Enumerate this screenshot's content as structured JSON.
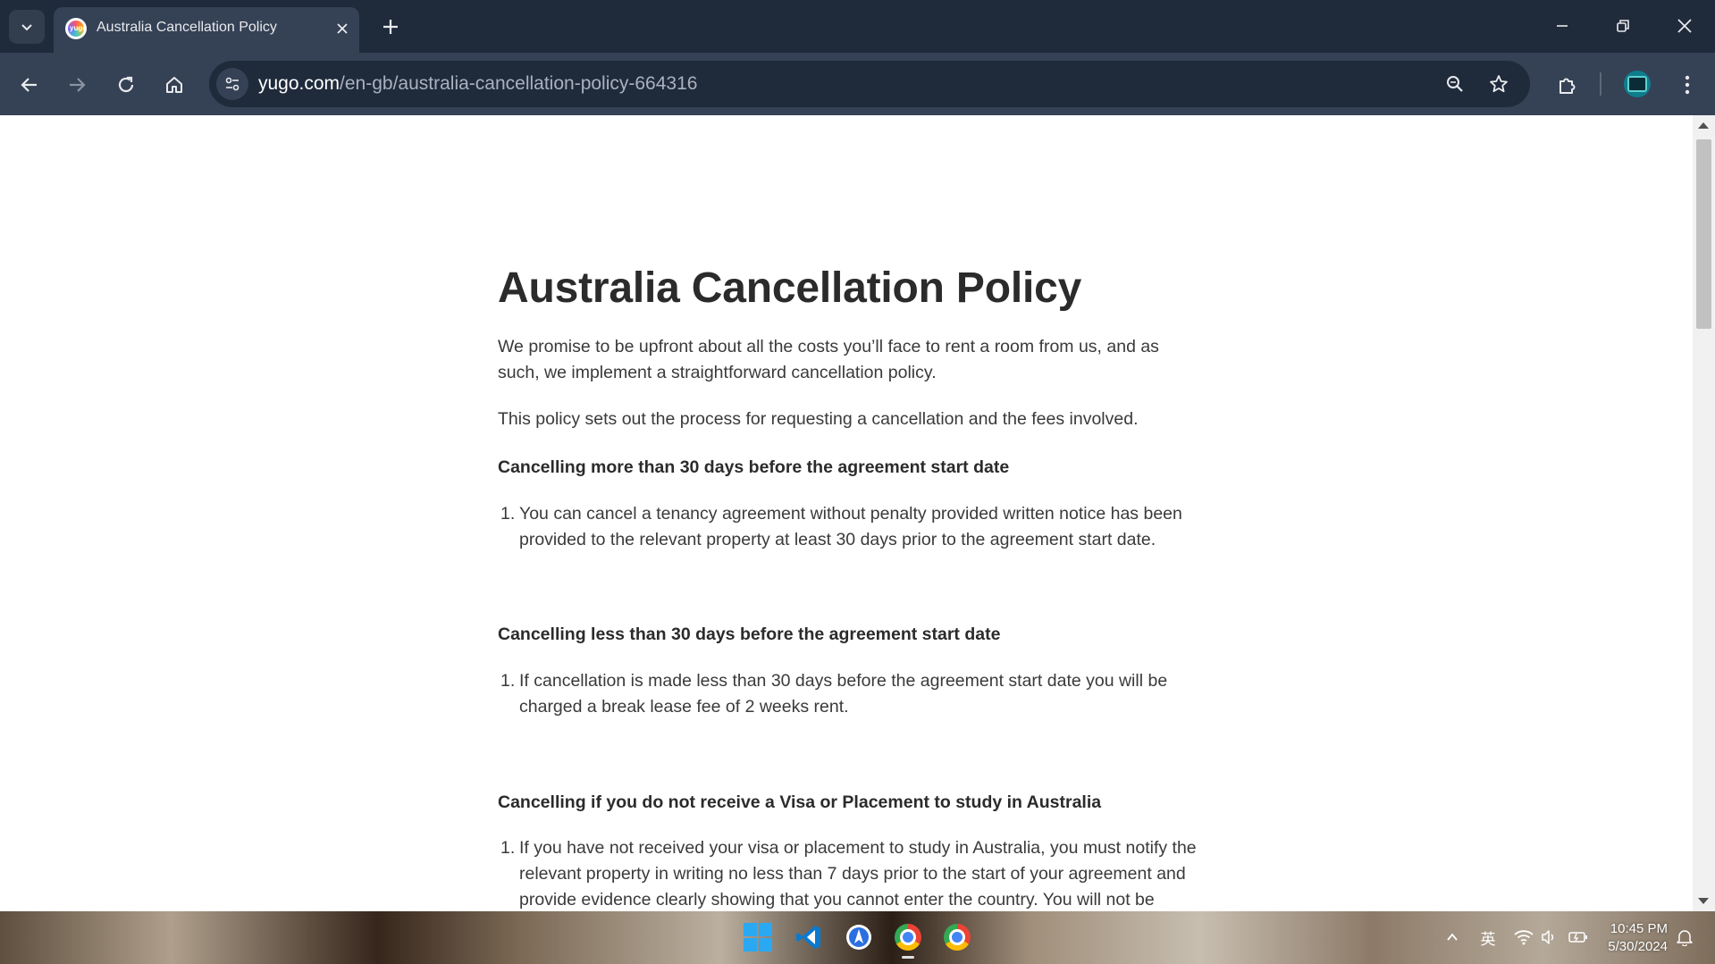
{
  "browser": {
    "tab": {
      "title": "Australia Cancellation Policy",
      "favicon_text": "yugo"
    },
    "url": {
      "domain": "yugo.com",
      "path": "/en-gb/australia-cancellation-policy-664316"
    }
  },
  "page": {
    "title": "Australia Cancellation Policy",
    "intro": [
      "We promise to be upfront about all the costs you’ll face to rent a room from us, and as such, we implement a straightforward cancellation policy.",
      "This policy sets out the process for requesting a cancellation and the fees involved."
    ],
    "sections": [
      {
        "heading": "Cancelling more than 30 days before the agreement start date",
        "item_number": "1.",
        "item_text": "You can cancel a tenancy agreement without penalty provided written notice has been provided to the relevant property at least 30 days prior to the agreement start date."
      },
      {
        "heading": "Cancelling less than 30 days before the agreement start date",
        "item_number": "1.",
        "item_text": "If cancellation is made less than 30 days before the agreement start date you will be charged a break lease fee of 2 weeks rent."
      },
      {
        "heading": "Cancelling if you do not receive a Visa or Placement to study in Australia",
        "item_number": "1.",
        "item_text": "If you have not received your visa or placement to study in Australia, you must notify the relevant property in writing no less than 7 days prior to the start of your agreement and provide evidence clearly showing that you cannot enter the country. You will not be"
      }
    ]
  },
  "taskbar": {
    "ime_label": "英",
    "time": "10:45 PM",
    "date": "5/30/2024"
  },
  "colors": {
    "tab_strip": "#1f2a3b",
    "toolbar": "#354155",
    "heading_text": "#2b2b2b",
    "body_text": "#3a3a3a"
  }
}
